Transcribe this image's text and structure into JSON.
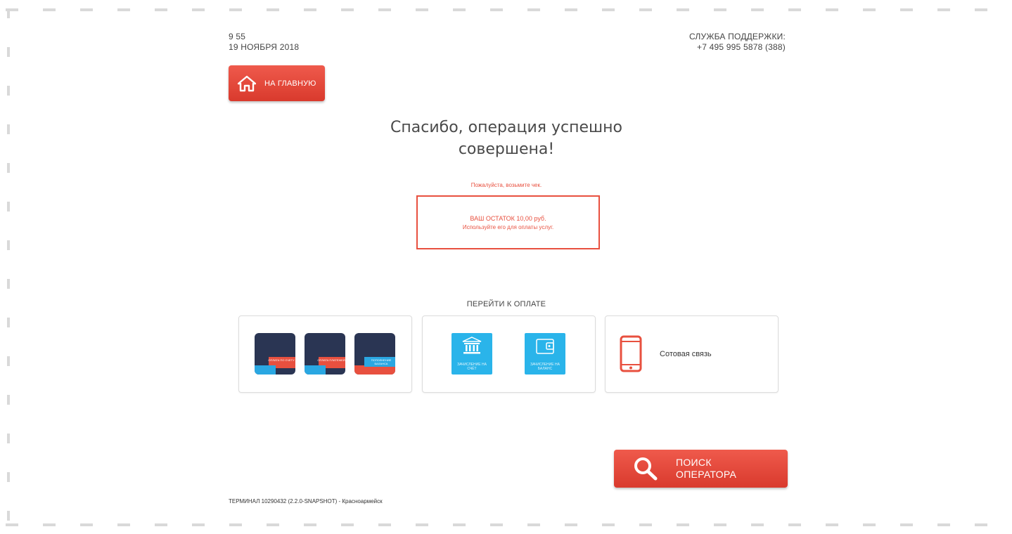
{
  "header": {
    "time": "9 55",
    "date": "19 НОЯБРЯ 2018",
    "support_label": "СЛУЖБА ПОДДЕРЖКИ:",
    "support_phone": "+7 495 995 5878 (388)"
  },
  "home_button": {
    "label": "НА ГЛАВНУЮ",
    "icon": "home-icon"
  },
  "main": {
    "thanks_line1": "Спасибо, операция успешно",
    "thanks_line2": "совершена!",
    "take_receipt": "Пожалуйста, возьмите чек.",
    "balance_line1": "ВАШ ОСТАТОК 10,00 руб.",
    "balance_line2": "Используйте его для оплаты услуг."
  },
  "payment": {
    "heading": "ПЕРЕЙТИ К ОПЛАТЕ",
    "card1_tiles": [
      "ОПЛАТА ПО СЧЕТУ",
      "ОПЛАТА ПЛАТЕЖЕЙ",
      "ПОПОЛНЕНИЕ БАЛАНСА"
    ],
    "card2_tiles": [
      "ЗАЧИСЛЕНИЕ НА СЧЁТ",
      "ЗАЧИСЛЕНИЕ НА БАЛАНС"
    ],
    "card3_label": "Сотовая связь"
  },
  "search_button": {
    "line1": "ПОИСК",
    "line2": "ОПЕРАТОРА",
    "icon": "search-icon"
  },
  "footer": {
    "terminal": "ТЕРМИНАЛ 10290432 (2.2.0-SNAPSHOT) - Красноармейск"
  },
  "colors": {
    "accent": "#e8503f",
    "dark_tile": "#2a3553",
    "blue_tile": "#2ab4ea",
    "link_blue": "#2aa7e2"
  }
}
